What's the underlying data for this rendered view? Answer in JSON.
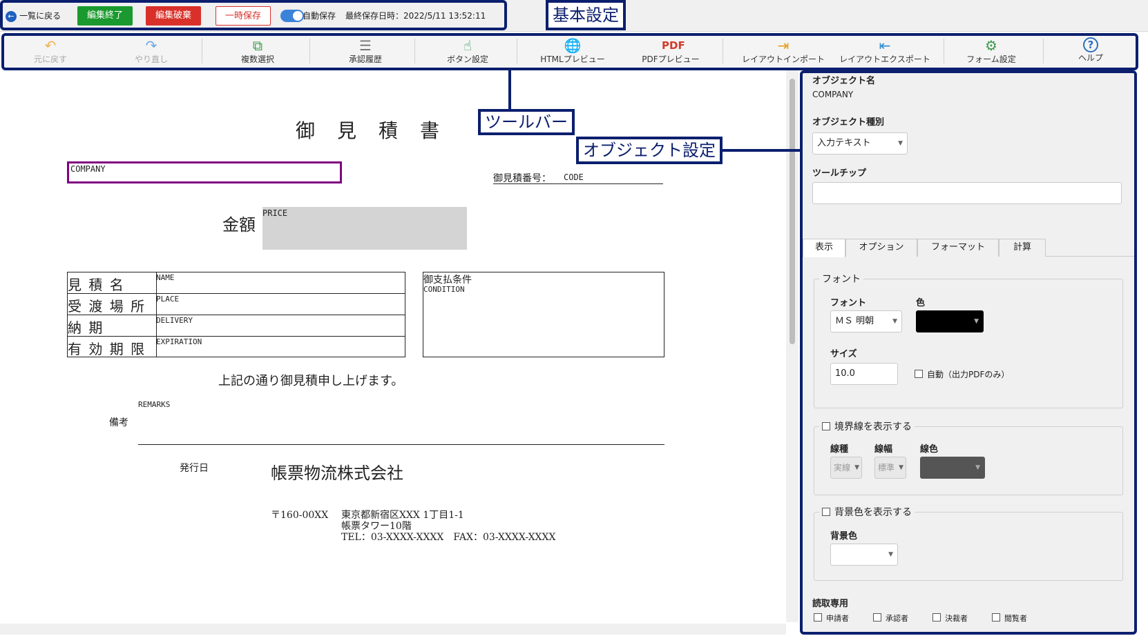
{
  "topbar": {
    "back_label": "一覧に戻る",
    "finish_edit": "編集終了",
    "discard_edit": "編集破棄",
    "temp_save": "一時保存",
    "autosave_label": "自動保存",
    "last_saved": "最終保存日時：2022/5/11 13:52:11",
    "autosave_on": true
  },
  "callouts": {
    "basic": "基本設定",
    "toolbar": "ツールバー",
    "object": "オブジェクト設定"
  },
  "toolbar": {
    "undo": "元に戻す",
    "redo": "やり直し",
    "multi_select": "複数選択",
    "approval_history": "承認履歴",
    "button_settings": "ボタン設定",
    "html_preview": "HTMLプレビュー",
    "pdf_preview": "PDFプレビュー",
    "layout_import": "レイアウトインポート",
    "layout_export": "レイアウトエクスポート",
    "form_settings": "フォーム設定",
    "help": "ヘルプ",
    "icons": [
      "undo-icon",
      "redo-icon",
      "multi-select-icon",
      "list-icon",
      "button-settings-icon",
      "globe-icon",
      "pdf-icon",
      "import-icon",
      "export-icon",
      "gear-icon",
      "help-icon"
    ]
  },
  "document": {
    "title": "御　見　積　書",
    "company_field": "COMPANY",
    "quote_no_label": "御見積番号：",
    "quote_no_value": "CODE",
    "amount_label": "金額",
    "price_field": "PRICE",
    "rows": [
      {
        "label": "見 積 名",
        "value": "NAME"
      },
      {
        "label": "受 渡 場 所",
        "value": "PLACE"
      },
      {
        "label": "納 期",
        "value": "DELIVERY"
      },
      {
        "label": "有 効 期 限",
        "value": "EXPIRATION"
      }
    ],
    "payment_label": "御支払条件",
    "payment_value": "CONDITION",
    "statement": "上記の通り御見積申し上げます。",
    "remarks_field": "REMARKS",
    "remarks_label": "備考",
    "issue_date_label": "発行日",
    "company_name": "帳票物流株式会社",
    "postal": "〒160-00XX",
    "address1": "東京都新宿区XXX 1丁目1-1",
    "address2": "帳票タワー10階",
    "contact": "TEL：03-XXXX-XXXX　FAX：03-XXXX-XXXX"
  },
  "panel": {
    "object_name_label": "オブジェクト名",
    "object_name_value": "COMPANY",
    "object_type_label": "オブジェクト種別",
    "object_type_value": "入力テキスト",
    "tooltip_label": "ツールチップ",
    "tooltip_value": "",
    "tabs": [
      "表示",
      "オプション",
      "フォーマット",
      "計算"
    ],
    "active_tab": "表示",
    "font_group": "フォント",
    "font_label": "フォント",
    "font_value": "ＭＳ 明朝",
    "color_label": "色",
    "color_value": "#000000",
    "size_label": "サイズ",
    "size_value": "10.0",
    "auto_label": "自動（出力PDFのみ）",
    "border_group": "境界線を表示する",
    "line_type_label": "線種",
    "line_type_value": "実線",
    "line_width_label": "線幅",
    "line_width_value": "標準",
    "line_color_label": "線色",
    "line_color_value": "#555555",
    "bg_group": "背景色を表示する",
    "bg_color_label": "背景色",
    "readonly_label": "読取専用",
    "readonly_options": [
      "申請者",
      "承認者",
      "決裁者",
      "閲覧者"
    ]
  },
  "colors": {
    "accent": "#0b1f6e",
    "green": "#1a9a2e",
    "red": "#d9302a",
    "toggle": "#3b82d9",
    "selection": "#800080"
  }
}
